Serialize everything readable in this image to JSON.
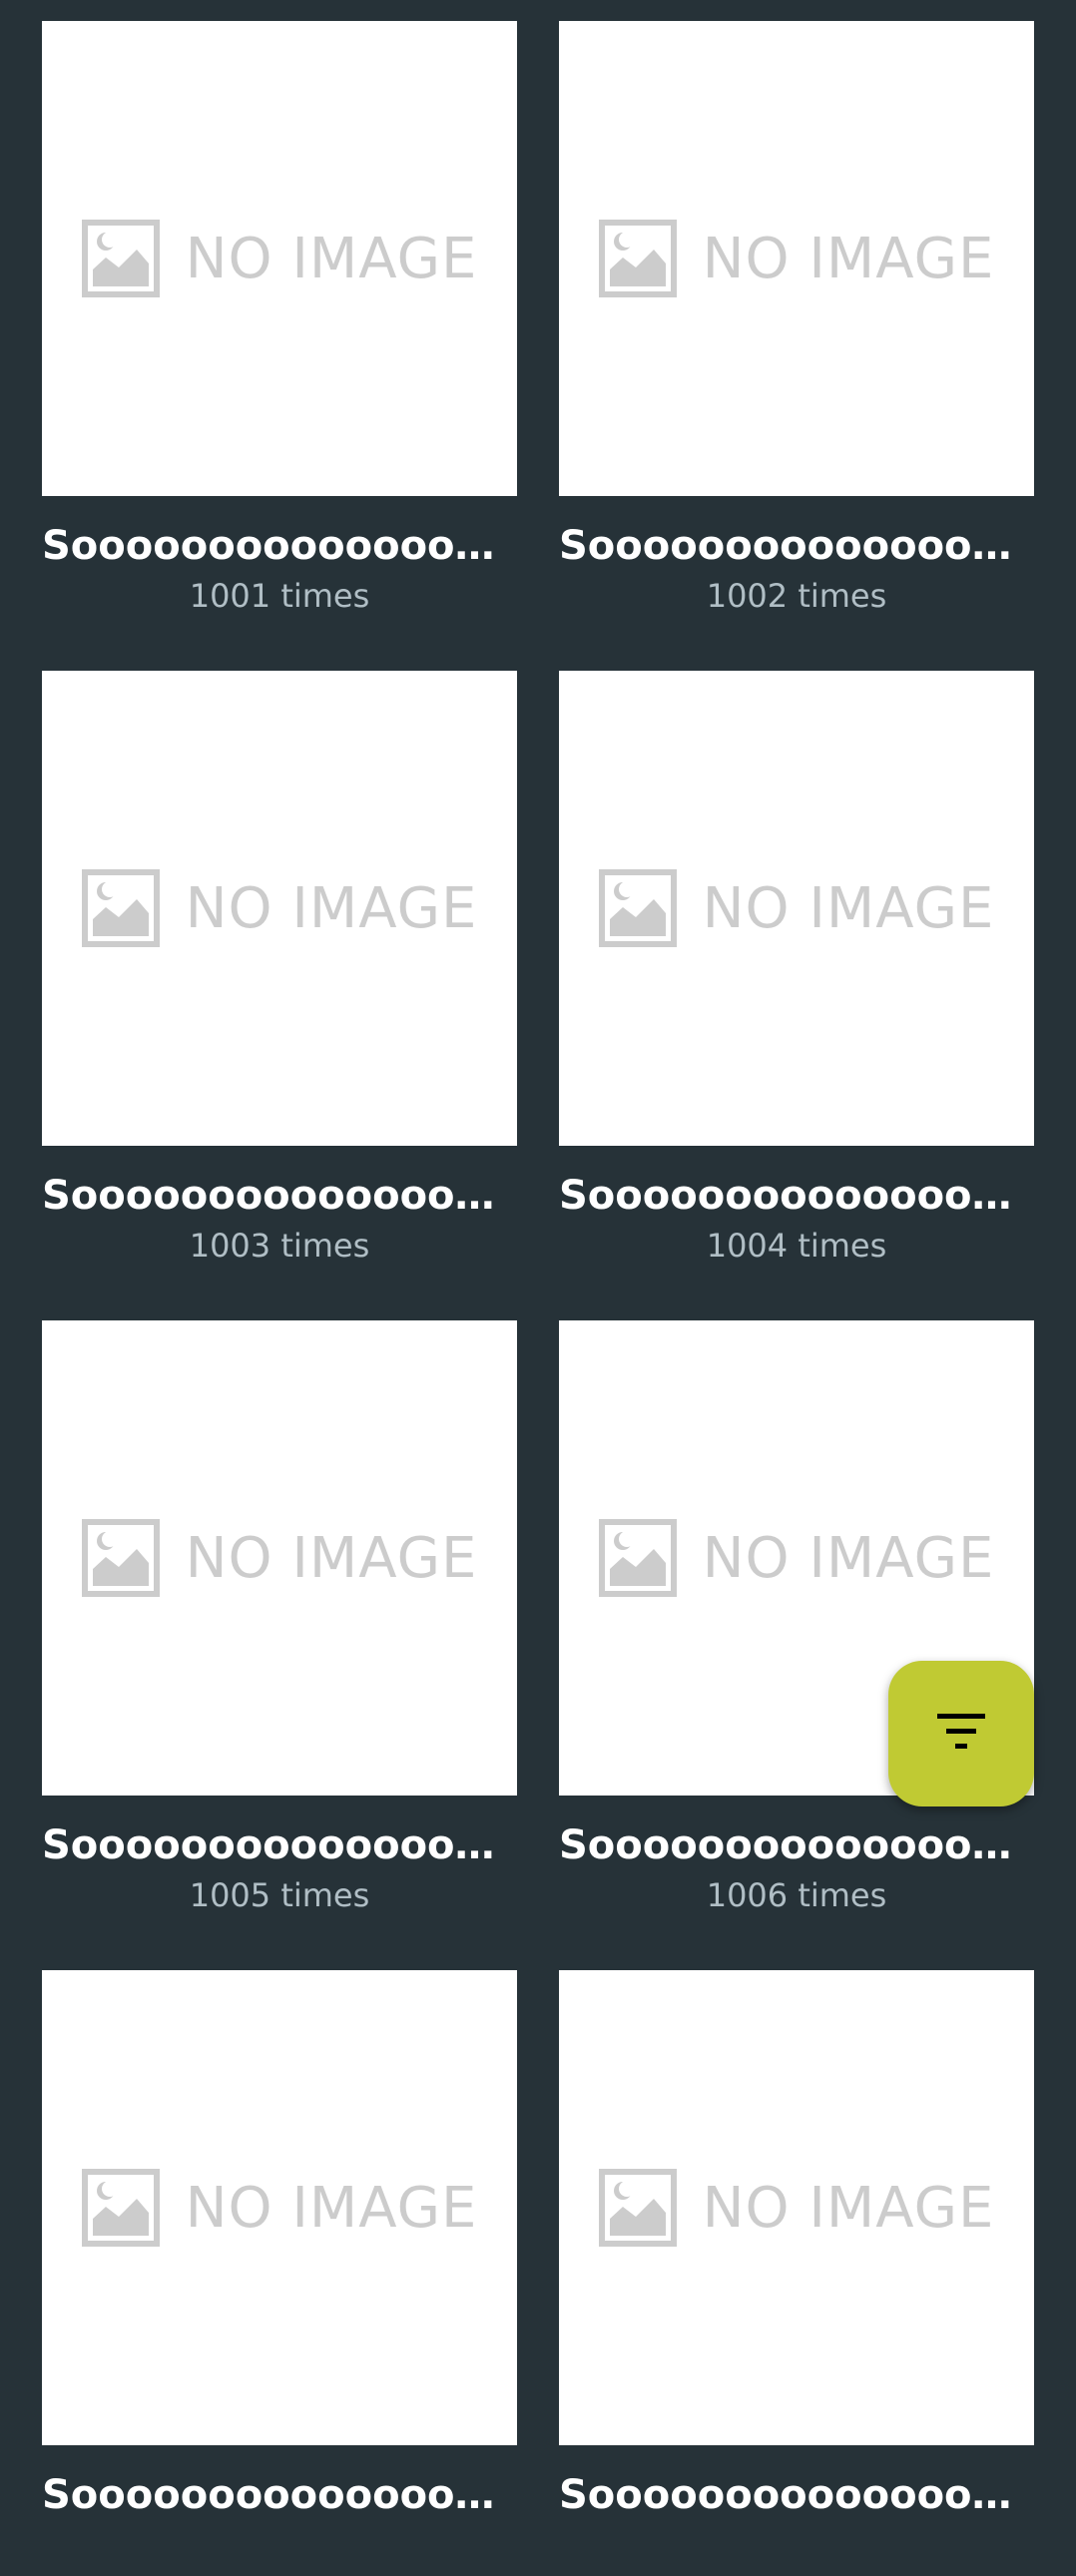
{
  "placeholder_text": "NO IMAGE",
  "items": [
    {
      "title": "Sooooooooooooooooooooooooooooo long title",
      "count": "1001 times"
    },
    {
      "title": "Sooooooooooooooooooooooooooooo long title",
      "count": "1002 times"
    },
    {
      "title": "Sooooooooooooooooooooooooooooo long title",
      "count": "1003 times"
    },
    {
      "title": "Sooooooooooooooooooooooooooooo long title",
      "count": "1004 times"
    },
    {
      "title": "Sooooooooooooooooooooooooooooo long title",
      "count": "1005 times"
    },
    {
      "title": "Sooooooooooooooooooooooooooooo long title",
      "count": "1006 times"
    },
    {
      "title": "Sooooooooooooooooooooooooooooo long title",
      "count": ""
    },
    {
      "title": "Sooooooooooooooooooooooooooooo long title",
      "count": ""
    }
  ],
  "fab": {
    "icon": "filter-icon"
  },
  "colors": {
    "background": "#263238",
    "accent": "#c0ca33",
    "placeholder": "#cccccc",
    "subtext": "#b0bec5"
  }
}
